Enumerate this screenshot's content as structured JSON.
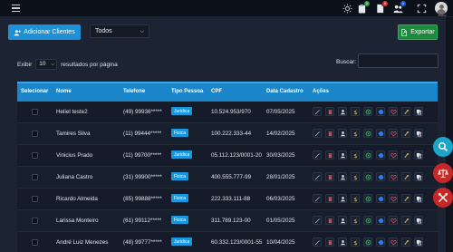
{
  "topbar": {
    "menu_icon": "hamburger-icon",
    "icons": [
      {
        "name": "sun-icon",
        "badge": "",
        "badge_color": ""
      },
      {
        "name": "clipboard-icon",
        "badge": "0",
        "badge_color": "#2e9d4a"
      },
      {
        "name": "file-icon",
        "badge": "0",
        "badge_color": "#d93030"
      },
      {
        "name": "users-icon",
        "badge": "1",
        "badge_color": "#1f5fd6"
      },
      {
        "name": "fullscreen-icon",
        "badge": "",
        "badge_color": ""
      }
    ],
    "avatar_label": "Cliente"
  },
  "toolbar": {
    "add_button_label": "Adicionar Clientes",
    "filter_value": "Todos",
    "export_button_label": "Exportar"
  },
  "table_controls": {
    "show_label": "Exibir",
    "page_length": "10",
    "per_page_label": "resultados por página",
    "search_label": "Buscar:",
    "search_value": ""
  },
  "table": {
    "headers": [
      "Selecionar",
      "Nome",
      "Telefone",
      "Tipo Pessoa",
      "CPF",
      "Data Cadastro",
      "Ações"
    ],
    "rows": [
      {
        "nome": "Heliel teste2",
        "telefone": "(49) 99936*****",
        "tipo": "Juridica",
        "cpf": "10.524.953/970",
        "data": "07/05/2025"
      },
      {
        "nome": "Tamires Silva",
        "telefone": "(11) 99444*****",
        "tipo": "Fisica",
        "cpf": "100.222.333-44",
        "data": "14/02/2025"
      },
      {
        "nome": "Vinicius Prado",
        "telefone": "(11) 99700*****",
        "tipo": "Juridica",
        "cpf": "05.112.123/0001-20",
        "data": "30/03/2025"
      },
      {
        "nome": "Juliana Castro",
        "telefone": "(31) 99900*****",
        "tipo": "Fisica",
        "cpf": "400.555.777-99",
        "data": "28/01/2025"
      },
      {
        "nome": "Ricardo Almeida",
        "telefone": "(85) 99888*****",
        "tipo": "Fisica",
        "cpf": "222.333.111-88",
        "data": "06/03/2025"
      },
      {
        "nome": "Larissa Monteiro",
        "telefone": "(61) 99112*****",
        "tipo": "Fisica",
        "cpf": "311.789.123-00",
        "data": "01/05/2025"
      },
      {
        "nome": "André Luiz Menezes",
        "telefone": "(48) 99777*****",
        "tipo": "Juridica",
        "cpf": "60.332.123/0001-55",
        "data": "10/04/2025"
      }
    ],
    "action_icons": [
      "edit-icon",
      "delete-icon",
      "user-icon",
      "dollar-icon",
      "whatsapp-icon",
      "info-icon",
      "heart-icon",
      "key-icon",
      "copy-icon"
    ]
  },
  "floating": [
    {
      "name": "search-fab-icon",
      "color": "#1aa5c9"
    },
    {
      "name": "balance-fab-icon",
      "color": "#c62828"
    },
    {
      "name": "tools-fab-icon",
      "color": "#c62828"
    }
  ],
  "colors": {
    "accent": "#1a85c9",
    "add_button": "#1f8fd6",
    "export_button": "#1b8a3d",
    "pill": "#1797e0"
  }
}
